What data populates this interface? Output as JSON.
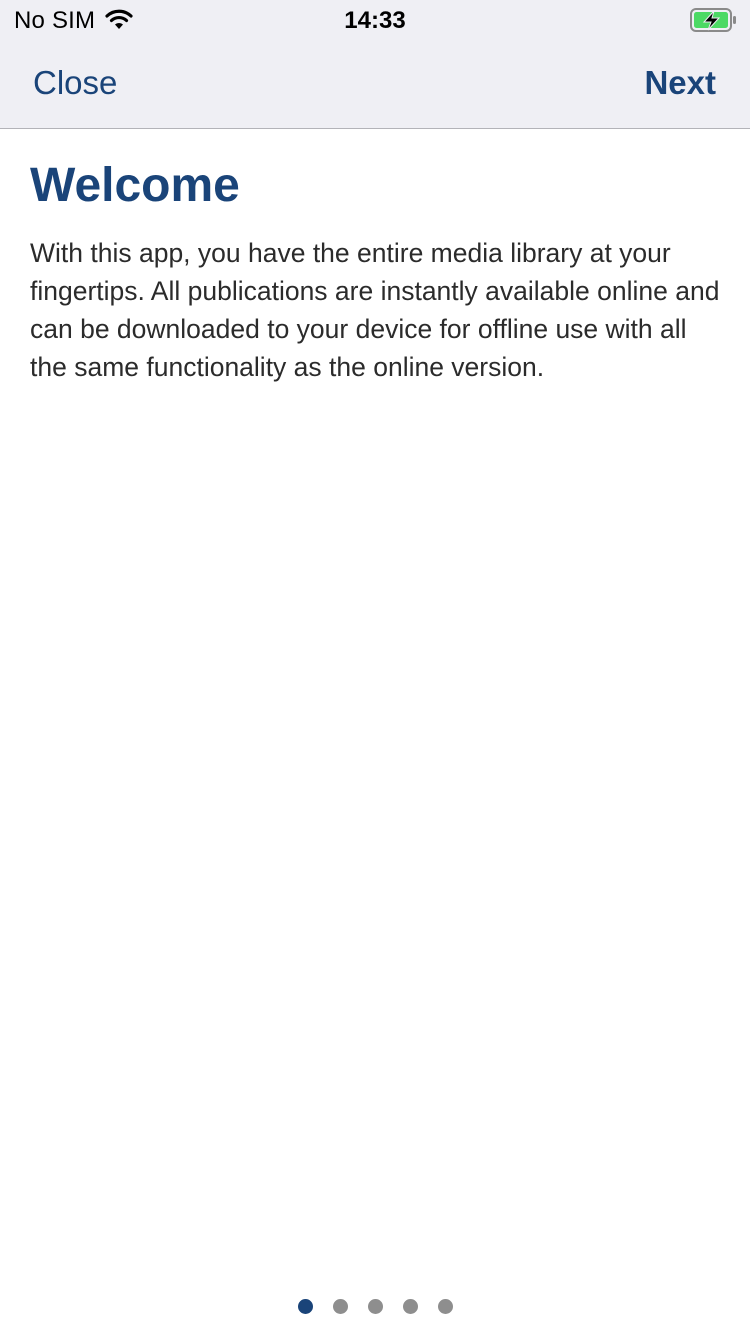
{
  "status_bar": {
    "carrier": "No SIM",
    "time": "14:33",
    "wifi_icon": "wifi-icon",
    "battery_icon": "battery-charging-icon",
    "battery_color": "#4cd964"
  },
  "nav": {
    "close_label": "Close",
    "next_label": "Next"
  },
  "content": {
    "title": "Welcome",
    "body": "With this app, you have the entire media library at your fingertips. All publications are instantly available online and can be downloaded to your device for offline use with all the same functionality as the online version."
  },
  "page_indicator": {
    "total_pages": 5,
    "current_page": 1
  },
  "colors": {
    "accent": "#1a4479",
    "nav_background": "#efeff4",
    "inactive_dot": "#8e8e8e"
  }
}
